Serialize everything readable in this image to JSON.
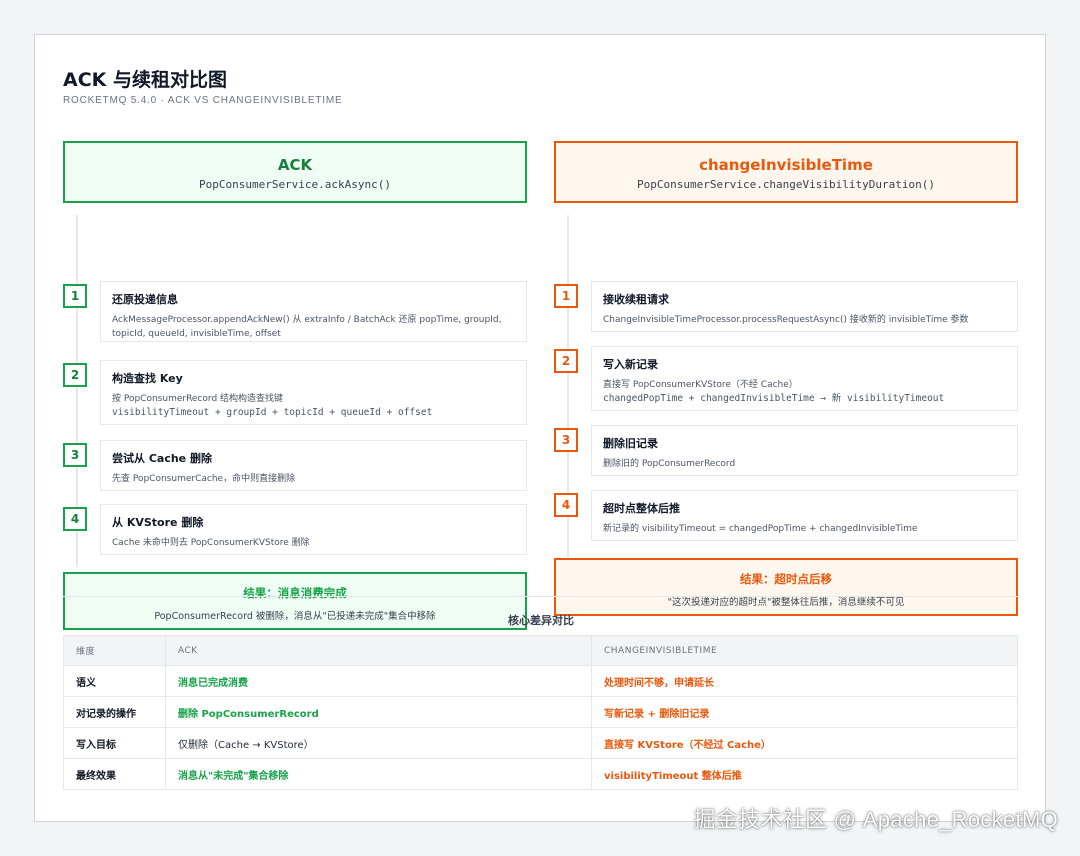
{
  "title": "ACK 与续租对比图",
  "subtitle": "ROCKETMQ 5.4.0 · ACK VS CHANGEINVISIBLETIME",
  "ack": {
    "heading": "ACK",
    "method": "PopConsumerService.ackAsync()",
    "steps": [
      {
        "num": "1",
        "title": "还原投递信息",
        "desc": "AckMessageProcessor.appendAckNew() 从 extraInfo / BatchAck 还原 popTime, groupId,",
        "desc2": "topicId, queueId, invisibleTime, offset"
      },
      {
        "num": "2",
        "title": "构造查找 Key",
        "desc": "按 PopConsumerRecord 结构构造查找键",
        "code": "visibilityTimeout + groupId + topicId + queueId + offset"
      },
      {
        "num": "3",
        "title": "尝试从 Cache 删除",
        "desc": "先查 PopConsumerCache，命中则直接删除"
      },
      {
        "num": "4",
        "title": "从 KVStore 删除",
        "desc": "Cache 未命中则去 PopConsumerKVStore 删除"
      }
    ],
    "result_title": "结果：消息消费完成",
    "result_desc": "PopConsumerRecord 被删除，消息从\"已投递未完成\"集合中移除"
  },
  "change": {
    "heading": "changeInvisibleTime",
    "method": "PopConsumerService.changeVisibilityDuration()",
    "steps": [
      {
        "num": "1",
        "title": "接收续租请求",
        "desc": "ChangeInvisibleTimeProcessor.processRequestAsync() 接收新的 invisibleTime 参数"
      },
      {
        "num": "2",
        "title": "写入新记录",
        "desc": "直接写 PopConsumerKVStore（不经 Cache）",
        "code": "changedPopTime + changedInvisibleTime → 新 visibilityTimeout"
      },
      {
        "num": "3",
        "title": "删除旧记录",
        "desc": "删除旧的 PopConsumerRecord"
      },
      {
        "num": "4",
        "title": "超时点整体后推",
        "desc": "新记录的 visibilityTimeout = changedPopTime + changedInvisibleTime"
      }
    ],
    "result_title": "结果：超时点后移",
    "result_desc": "\"这次投递对应的超时点\"被整体往后推，消息继续不可见"
  },
  "table": {
    "title": "核心差异对比",
    "headers": [
      "维度",
      "ACK",
      "CHANGEINVISIBLETIME"
    ],
    "rows": [
      {
        "dim": "语义",
        "ack": "消息已完成消费",
        "change": "处理时间不够，申请延长"
      },
      {
        "dim": "对记录的操作",
        "ack": "删除 PopConsumerRecord",
        "change": "写新记录 + 删除旧记录"
      },
      {
        "dim": "写入目标",
        "ack": "仅删除（Cache → KVStore）",
        "change": "直接写 KVStore（不经过 Cache）"
      },
      {
        "dim": "最终效果",
        "ack": "消息从\"未完成\"集合移除",
        "change": "visibilityTimeout 整体后推"
      }
    ]
  },
  "watermark": "掘金技术社区 @ Apache_RocketMQ",
  "colors": {
    "ack": "#16a34a",
    "change": "#ea580c"
  }
}
